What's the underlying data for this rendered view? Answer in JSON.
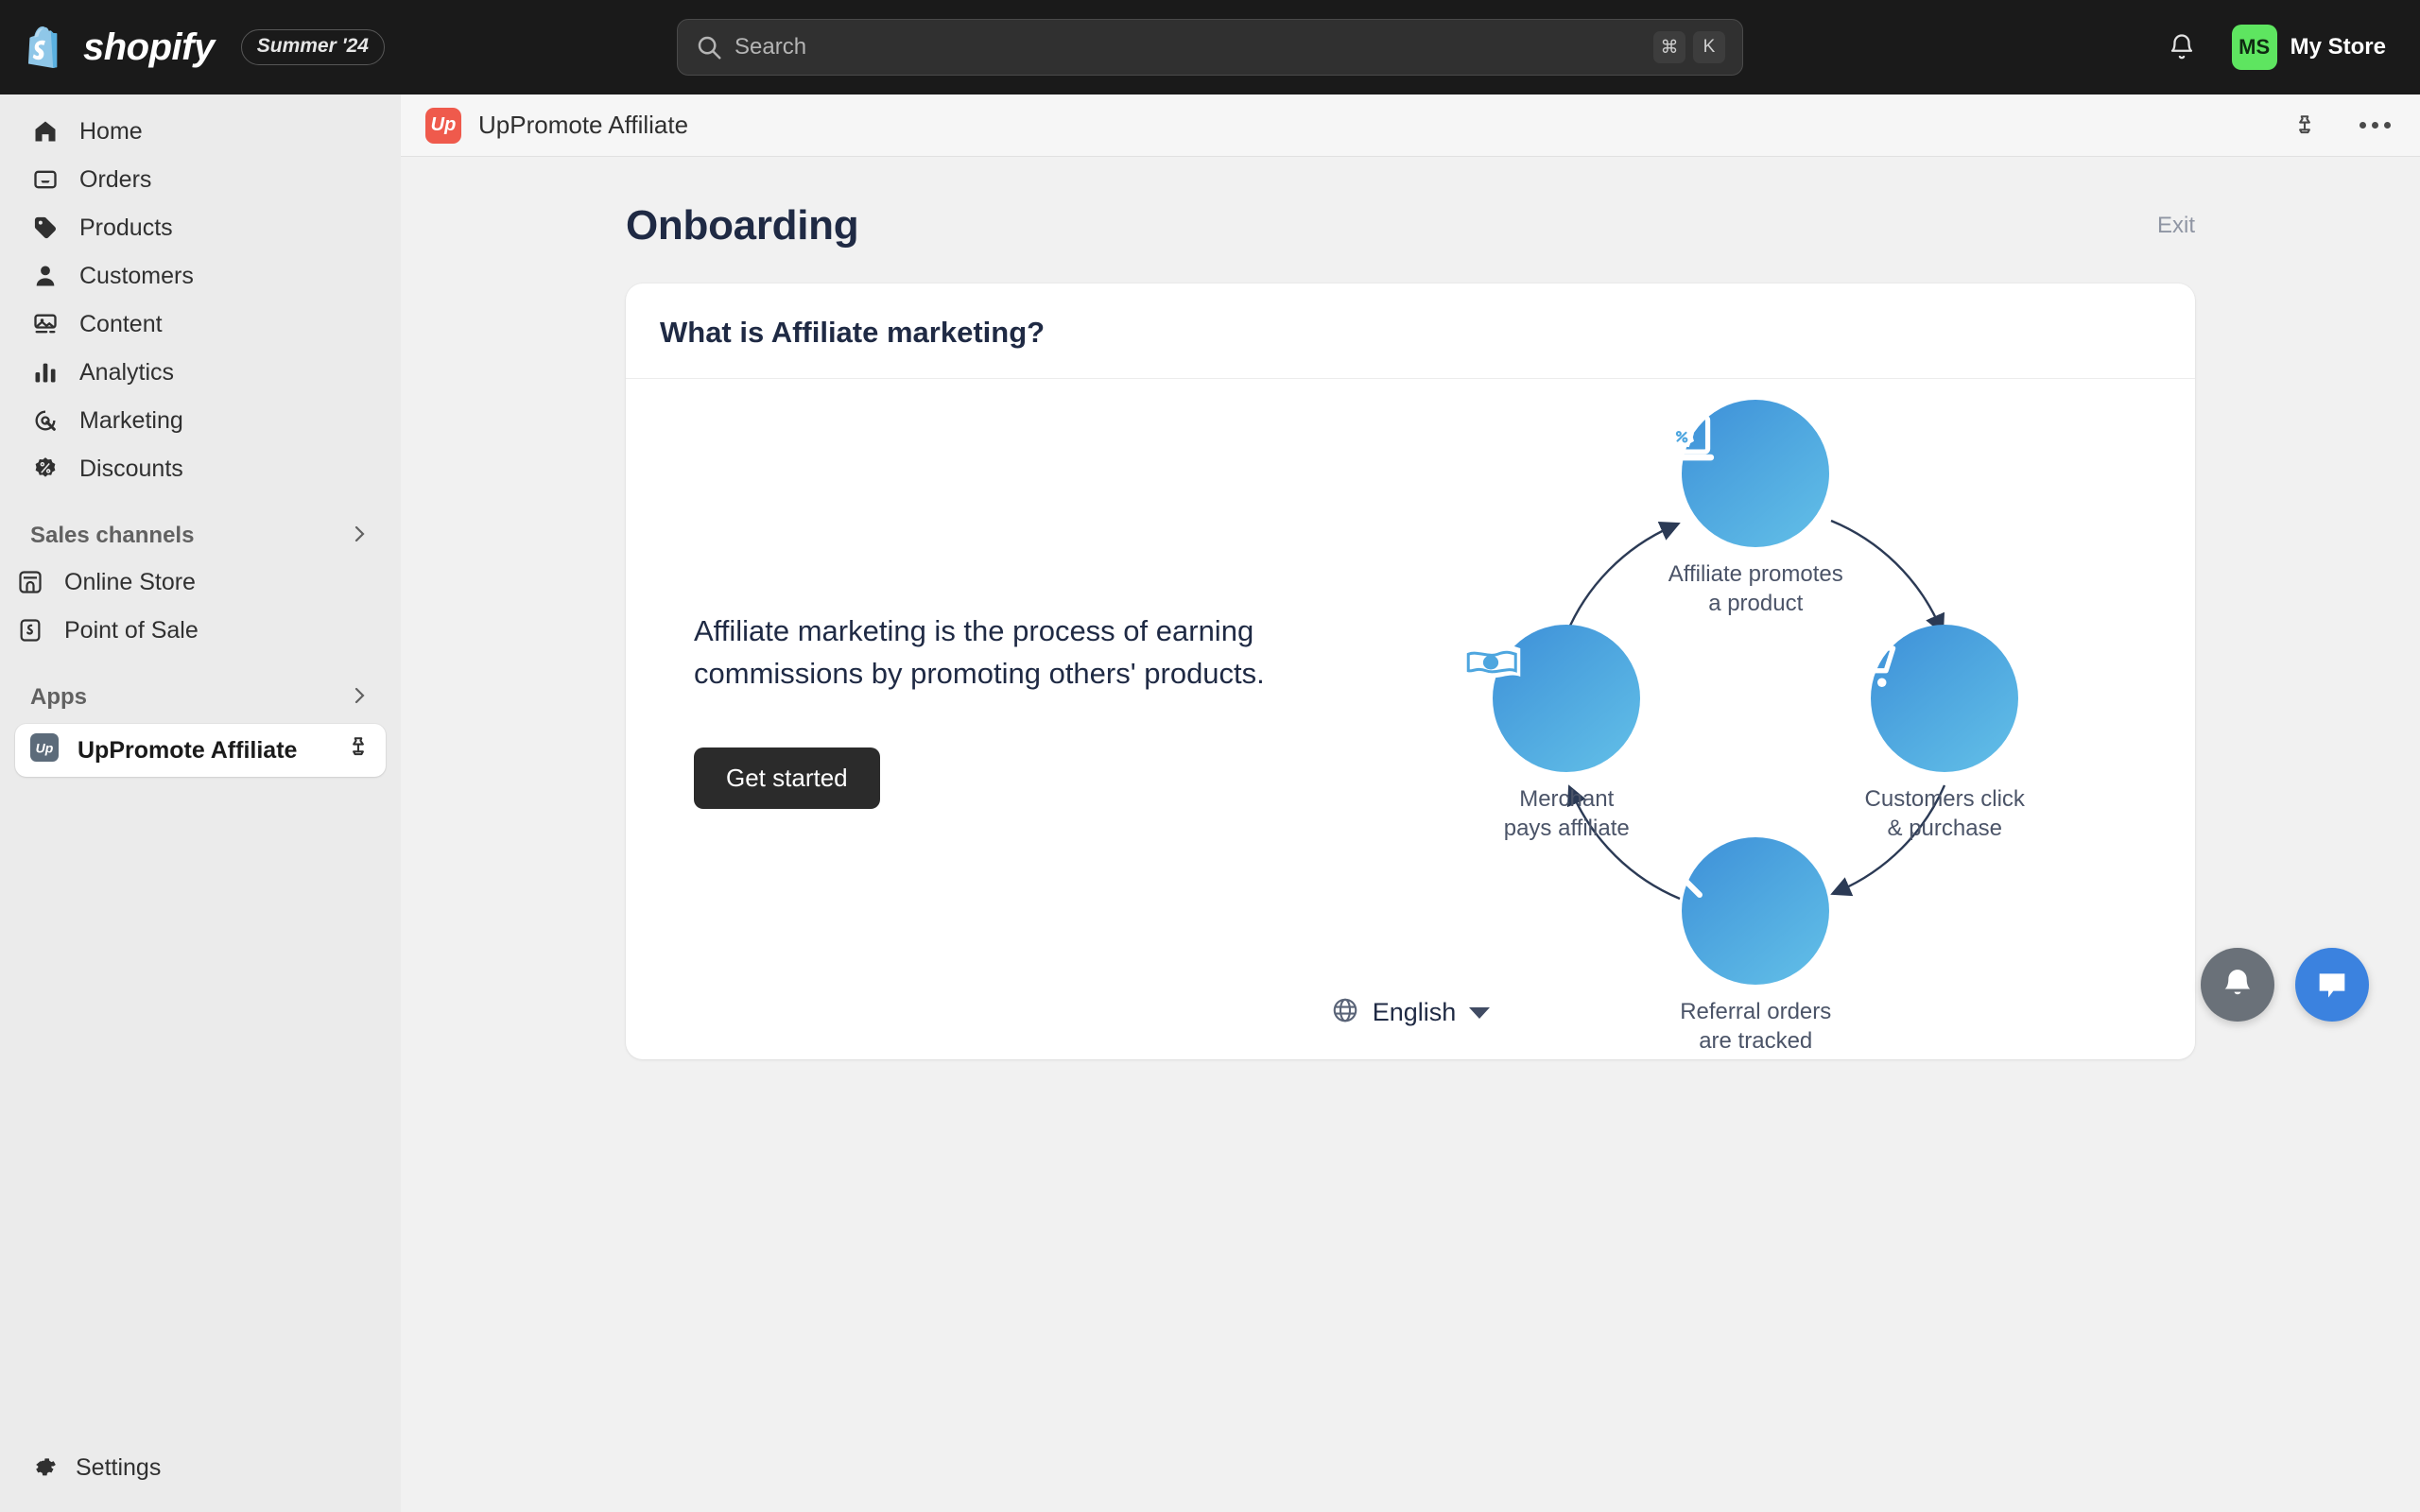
{
  "topbar": {
    "brand_name": "shopify",
    "season_badge": "Summer '24",
    "search": {
      "placeholder": "Search",
      "kbd_cmd": "⌘",
      "kbd_key": "K"
    },
    "notifications_icon": "bell-icon",
    "account": {
      "initials": "MS",
      "store_name": "My Store"
    }
  },
  "sidebar": {
    "items": [
      {
        "label": "Home",
        "icon": "home-icon"
      },
      {
        "label": "Orders",
        "icon": "orders-icon"
      },
      {
        "label": "Products",
        "icon": "tag-icon"
      },
      {
        "label": "Customers",
        "icon": "person-icon"
      },
      {
        "label": "Content",
        "icon": "image-icon"
      },
      {
        "label": "Analytics",
        "icon": "bar-chart-icon"
      },
      {
        "label": "Marketing",
        "icon": "target-click-icon"
      },
      {
        "label": "Discounts",
        "icon": "discount-badge-icon"
      }
    ],
    "sales_channels": {
      "label": "Sales channels",
      "chevron": "chevron-right-icon",
      "items": [
        {
          "label": "Online Store",
          "icon": "storefront-icon"
        },
        {
          "label": "Point of Sale",
          "icon": "pos-icon"
        }
      ]
    },
    "apps": {
      "label": "Apps",
      "chevron": "chevron-right-icon",
      "active_app": {
        "label": "UpPromote Affiliate",
        "icon": "uppromote-icon",
        "pin": "pin-icon"
      }
    },
    "settings": {
      "label": "Settings",
      "icon": "gear-icon"
    }
  },
  "app_header": {
    "logo_text": "Up",
    "title": "UpPromote Affiliate",
    "pin_icon": "pin-icon",
    "more_icon": "more-options-icon"
  },
  "page": {
    "title": "Onboarding",
    "exit_label": "Exit",
    "card": {
      "heading": "What is Affiliate marketing?",
      "lead": "Affiliate marketing is the process of earning commissions by promoting others' products.",
      "cta_label": "Get started"
    }
  },
  "diagram": {
    "nodes": [
      {
        "caption_line1": "Affiliate promotes",
        "caption_line2": "a product",
        "icon": "laptop-discount-icon"
      },
      {
        "caption_line1": "Customers click",
        "caption_line2": "& purchase",
        "icon": "shopping-cart-icon"
      },
      {
        "caption_line1": "Referral orders",
        "caption_line2": "are tracked",
        "icon": "magnifier-icon"
      },
      {
        "caption_line1": "Merchant",
        "caption_line2": "pays affiliate",
        "icon": "banknote-icon"
      }
    ],
    "flow_direction": "clockwise"
  },
  "footer": {
    "language": {
      "label": "English",
      "icon": "globe-icon",
      "caret": "chevron-down-icon"
    },
    "fabs": [
      {
        "name": "notifications-fab",
        "icon": "bell-icon",
        "color": "#6a7179"
      },
      {
        "name": "chat-fab",
        "icon": "chat-bubble-icon",
        "color": "#3b82df"
      }
    ]
  }
}
